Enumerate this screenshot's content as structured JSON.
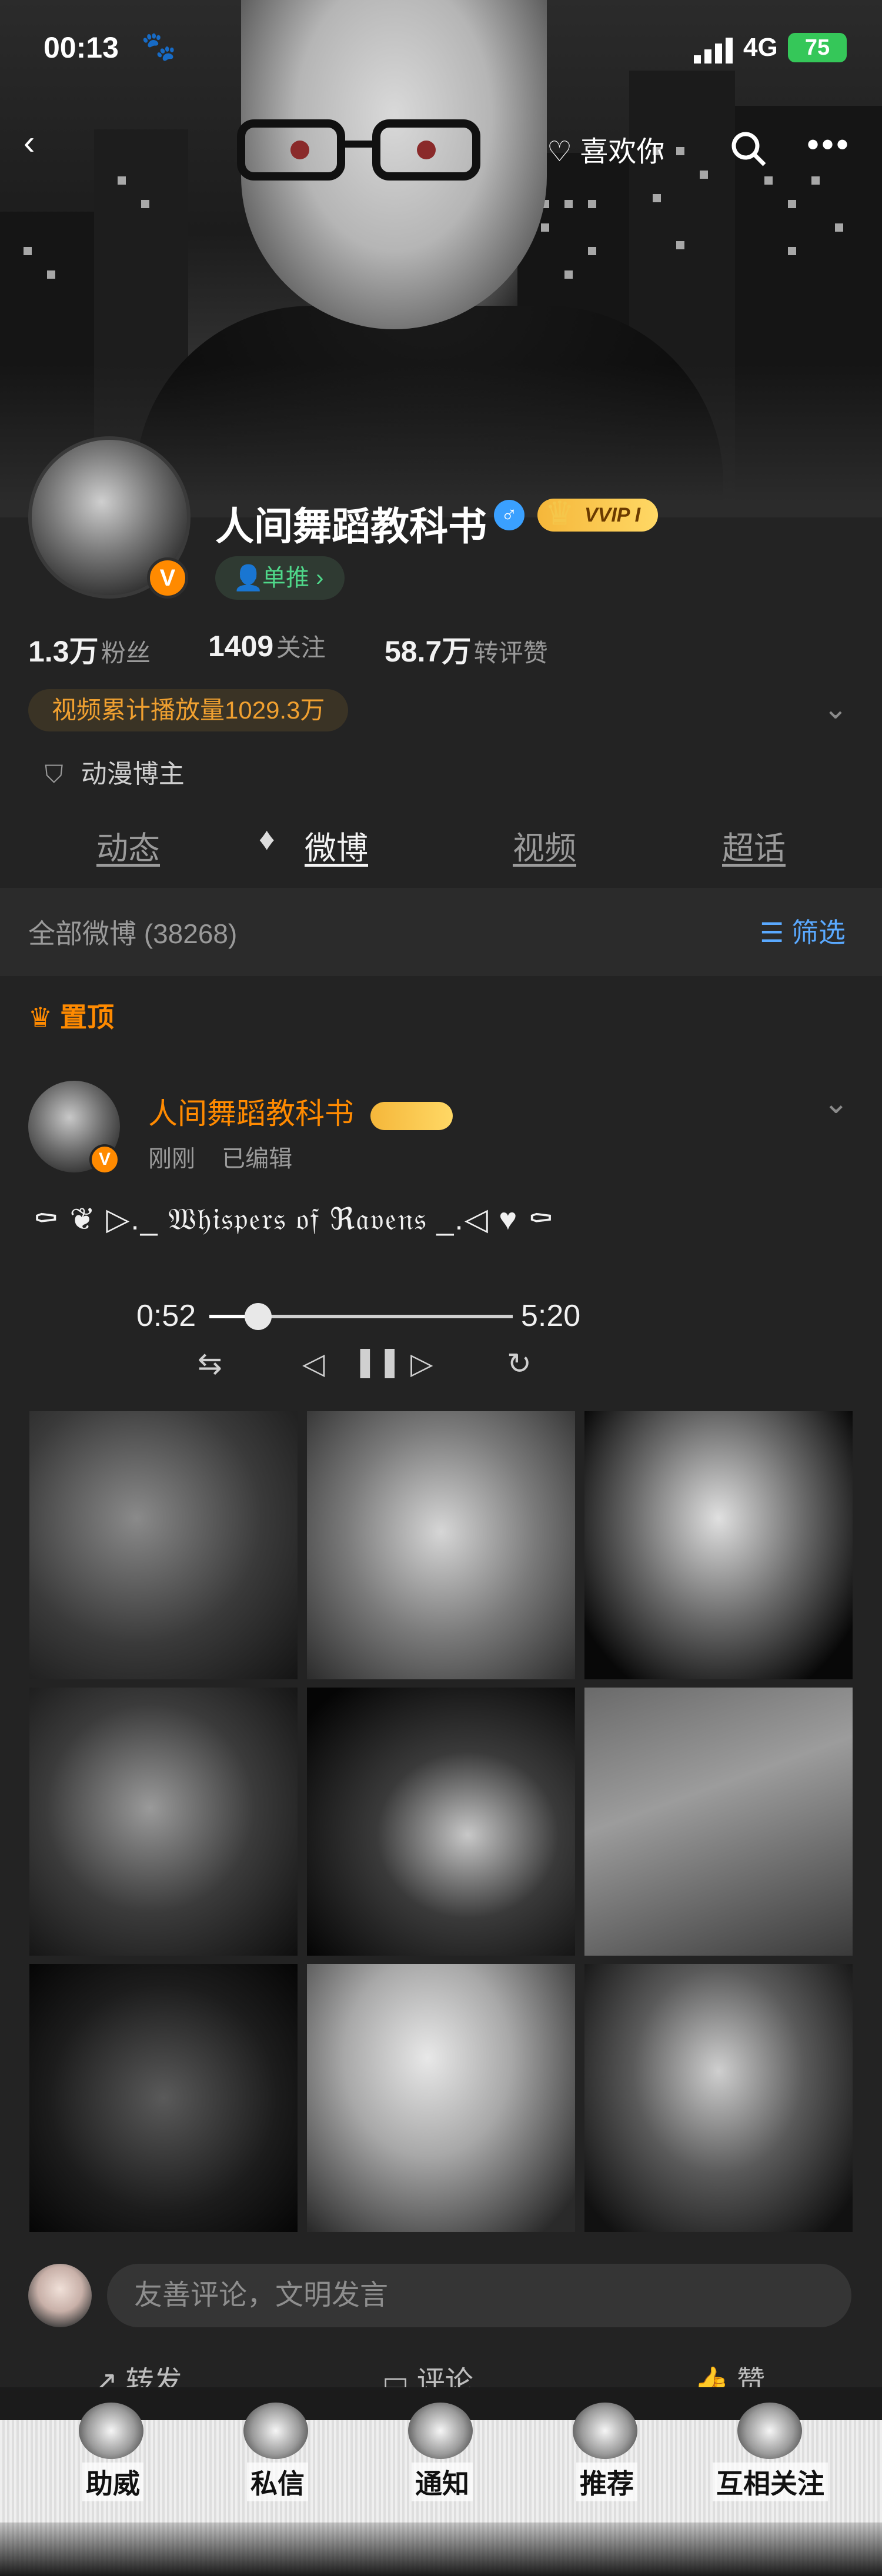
{
  "status_bar": {
    "time": "00:13",
    "network": "4G",
    "battery": "75"
  },
  "topbar": {
    "like_label": "喜欢你"
  },
  "profile": {
    "name": "人间舞蹈教科书",
    "vvip_label": "VVIP I",
    "recommend_label": "单推",
    "followers_num": "1.3万",
    "followers_label": "粉丝",
    "following_num": "1409",
    "following_label": "关注",
    "reposts_num": "58.7万",
    "reposts_label": "转评赞",
    "play_count": "视频累计播放量1029.3万",
    "tag": "动漫博主"
  },
  "tabs": [
    {
      "label": "动态"
    },
    {
      "label": "微博"
    },
    {
      "label": "视频"
    },
    {
      "label": "超话"
    }
  ],
  "list_header": {
    "title": "全部微博 (38268)",
    "filter_label": "筛选"
  },
  "post": {
    "pinned_label": "置顶",
    "author": "人间舞蹈教科书",
    "time": "刚刚",
    "edited": "已编辑",
    "text": "⚰ ❦ ▷._ 𝔚𝔥𝔦𝔰𝔭𝔢𝔯𝔰 𝔬𝔣 ℜ𝔞𝔳𝔢𝔫𝔰 _.◁ ♥ ⚰",
    "player": {
      "current": "0:52",
      "total": "5:20",
      "progress": 0.16
    }
  },
  "comment": {
    "placeholder": "友善评论，文明发言"
  },
  "actions": {
    "repost": "转发",
    "comment": "评论",
    "like": "赞"
  },
  "bottom_nav": [
    {
      "label": "助威"
    },
    {
      "label": "私信"
    },
    {
      "label": "通知"
    },
    {
      "label": "推荐"
    },
    {
      "label": "互相关注"
    }
  ],
  "colors": {
    "accent": "#ff8a00",
    "background": "#232323",
    "link": "#5aa9ff"
  }
}
